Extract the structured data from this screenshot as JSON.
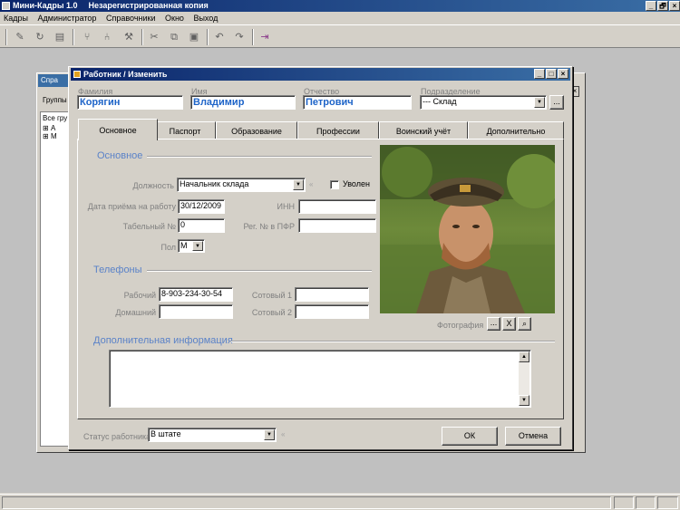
{
  "app": {
    "title": "Мини-Кадры 1.0",
    "license_note": "Незарегистрированная копия",
    "window_buttons": [
      "_",
      "🗗",
      "×"
    ]
  },
  "menu": [
    "Кадры",
    "Администратор",
    "Справочники",
    "Окно",
    "Выход"
  ],
  "background_window": {
    "title": "Спра",
    "groups_label": "Группы",
    "tree_header": "Все гру",
    "tree_items": [
      "А",
      "М"
    ]
  },
  "dialog": {
    "title": "Работник / Изменить",
    "window_buttons": [
      "_",
      "□",
      "×"
    ],
    "labels": {
      "last_name": "Фамилия",
      "first_name": "Имя",
      "patronymic": "Отчество",
      "department": "Подразделение"
    },
    "values": {
      "last_name": "Корягин",
      "first_name": "Владимир",
      "patronymic": "Петрович",
      "department": "---  Склад"
    },
    "tabs": [
      "Основное",
      "Паспорт",
      "Образование",
      "Профессии",
      "Воинский учёт",
      "Дополнительно"
    ],
    "active_tab": 0,
    "main": {
      "section_title": "Основное",
      "position_label": "Должность",
      "position_value": "Начальник склада",
      "fired_label": "Уволен",
      "hire_date_label": "Дата приёма на работу",
      "hire_date_value": "30/12/2009",
      "inn_label": "ИНН",
      "inn_value": "",
      "tab_number_label": "Табельный №",
      "tab_number_value": "0",
      "pfr_label": "Рег. № в ПФР",
      "pfr_value": "",
      "gender_label": "Пол",
      "gender_value": "М"
    },
    "phones": {
      "section_title": "Телефоны",
      "work_label": "Рабочий",
      "work_value": "8-903-234-30-54",
      "home_label": "Домашний",
      "home_value": "",
      "mobile1_label": "Сотовый 1",
      "mobile1_value": "",
      "mobile2_label": "Сотовый 2",
      "mobile2_value": ""
    },
    "photo_label": "Фотография",
    "photo_buttons": [
      "...",
      "X"
    ],
    "extra": {
      "section_title": "Дополнительная информация",
      "value": ""
    },
    "footer": {
      "status_label": "Статус работника",
      "status_value": "В штате",
      "ok_label": "ОК",
      "cancel_label": "Отмена"
    }
  },
  "colors": {
    "title_gradient_start": "#0a246a",
    "title_gradient_end": "#3a6ea5",
    "name_text": "#1e64c8",
    "section_text": "#5a82c8",
    "face": "#d4d0c8"
  }
}
